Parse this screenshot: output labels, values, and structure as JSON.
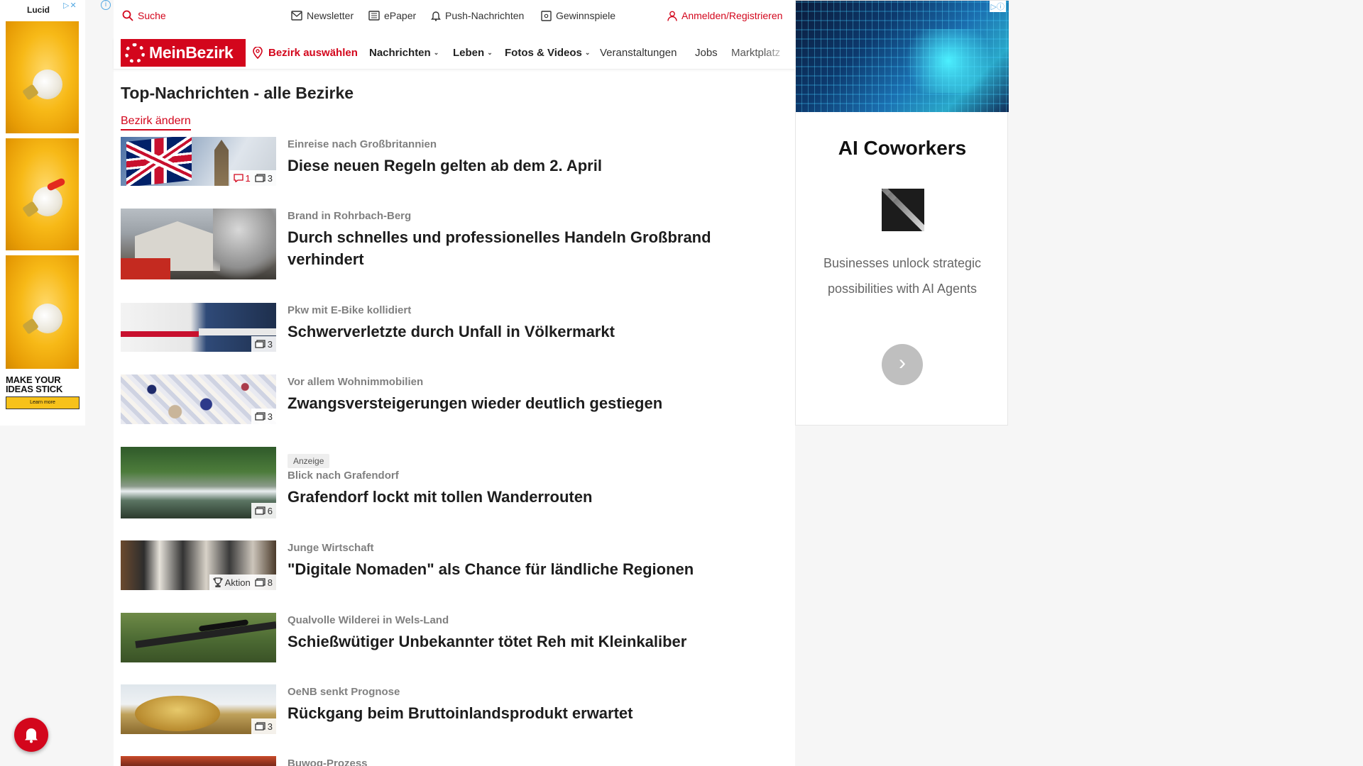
{
  "ad_left": {
    "brand": "Lucid",
    "adchoices": "▷✕",
    "tagline": "MAKE YOUR IDEAS STICK",
    "cta": "Learn more"
  },
  "topbar": {
    "search": "Suche",
    "newsletter": "Newsletter",
    "epaper": "ePaper",
    "push": "Push-Nachrichten",
    "gewinnspiele": "Gewinnspiele",
    "login": "Anmelden/Registrieren"
  },
  "nav": {
    "logo": "MeinBezirk",
    "bezirk": "Bezirk auswählen",
    "items": [
      {
        "label": "Nachrichten"
      },
      {
        "label": "Leben"
      },
      {
        "label": "Fotos & Videos"
      },
      {
        "label": "Veranstaltungen"
      },
      {
        "label": "Jobs"
      },
      {
        "label": "Marktplatz"
      }
    ]
  },
  "section": {
    "title": "Top-Nachrichten - alle Bezirke",
    "change_link": "Bezirk ändern"
  },
  "articles": [
    {
      "kicker": "Einreise nach Großbritannien",
      "headline": "Diese neuen Regeln gelten ab dem 2. April",
      "comments": "1",
      "photos": "3"
    },
    {
      "kicker": "Brand in Rohrbach-Berg",
      "headline": "Durch schnelles und professionelles Handeln Großbrand verhindert"
    },
    {
      "kicker": "Pkw mit E-Bike kollidiert",
      "headline": "Schwerverletzte durch Unfall in Völkermarkt",
      "photos": "3"
    },
    {
      "kicker": "Vor allem Wohnimmobilien",
      "headline": "Zwangsversteigerungen wieder deutlich gestiegen",
      "photos": "3"
    },
    {
      "anzeige": "Anzeige",
      "kicker": "Blick nach Grafendorf",
      "headline": "Grafendorf lockt mit tollen Wanderrouten",
      "photos": "6"
    },
    {
      "kicker": "Junge Wirtschaft",
      "headline": "\"Digitale Nomaden\" als Chance für ländliche Regionen",
      "aktion": "Aktion",
      "photos": "8"
    },
    {
      "kicker": "Qualvolle Wilderei in Wels-Land",
      "headline": "Schießwütiger Unbekannter tötet Reh mit Kleinkaliber"
    },
    {
      "kicker": "OeNB senkt Prognose",
      "headline": "Rückgang beim Bruttoinlandsprodukt erwartet",
      "photos": "3"
    },
    {
      "kicker": "Buwog-Prozess"
    }
  ],
  "ad_right": {
    "title": "AI Coworkers",
    "description": "Businesses unlock strategic possibilities with AI Agents",
    "adchoices": "▷ⓘ",
    "next": "›"
  },
  "icons": {
    "search": "search-icon",
    "bell": "bell-icon",
    "comment": "comment-icon",
    "photo": "photo-icon",
    "trophy": "trophy-icon",
    "map_pin": "map-pin-icon",
    "user": "user-icon"
  },
  "colors": {
    "brand_red": "#d3061c",
    "kicker_gray": "#808080",
    "link_blue": "#53a8e2"
  }
}
